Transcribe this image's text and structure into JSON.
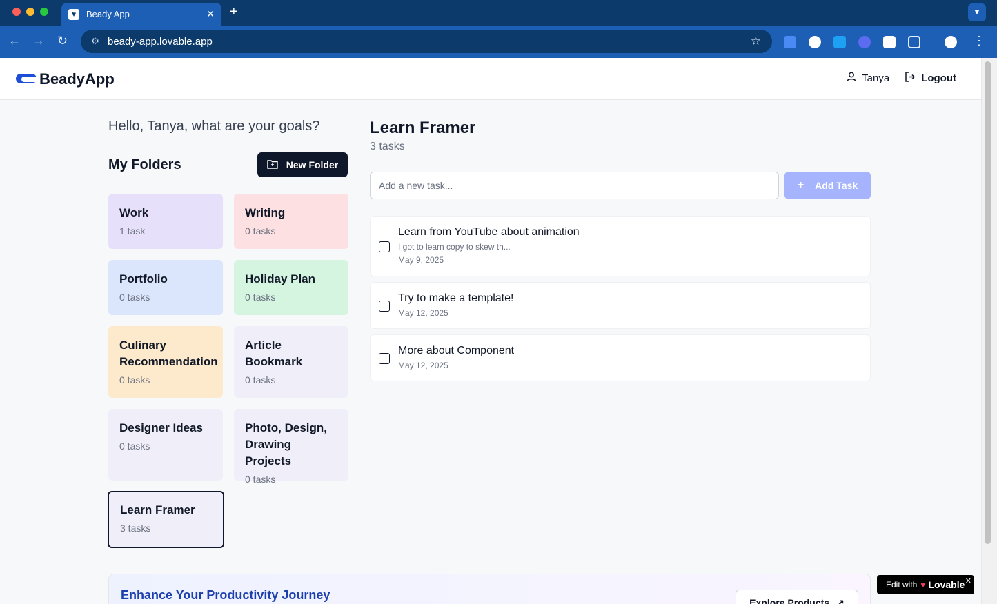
{
  "browser": {
    "tab_title": "Beady App",
    "url": "beady-app.lovable.app"
  },
  "header": {
    "logo_text": "BeadyApp",
    "user_name": "Tanya",
    "logout_label": "Logout"
  },
  "sidebar": {
    "greeting": "Hello, Tanya, what are your goals?",
    "folders_title": "My Folders",
    "new_folder_label": "New Folder",
    "folders": [
      {
        "name": "Work",
        "count": "1 task",
        "color": "#e7e0fb"
      },
      {
        "name": "Writing",
        "count": "0 tasks",
        "color": "#fde0e2"
      },
      {
        "name": "Portfolio",
        "count": "0 tasks",
        "color": "#dbe6fd"
      },
      {
        "name": "Holiday Plan",
        "count": "0 tasks",
        "color": "#d6f5e1"
      },
      {
        "name": "Culinary Recommendation",
        "count": "0 tasks",
        "color": "#fde9cc"
      },
      {
        "name": "Article Bookmark",
        "count": "0 tasks",
        "color": "#f0eff9"
      },
      {
        "name": "Designer Ideas",
        "count": "0 tasks",
        "color": "#f0eff9"
      },
      {
        "name": "Photo, Design, Drawing Projects",
        "count": "0 tasks",
        "color": "#f0eff9"
      },
      {
        "name": "Learn Framer",
        "count": "3 tasks",
        "color": "#f0eff9"
      }
    ]
  },
  "main": {
    "list_title": "Learn Framer",
    "list_count": "3 tasks",
    "input_placeholder": "Add a new task...",
    "add_task_label": "Add Task",
    "tasks": [
      {
        "title": "Learn from YouTube about animation",
        "description": "I got to learn copy to skew th...",
        "date": "May 9, 2025"
      },
      {
        "title": "Try to make a template!",
        "date": "May 12, 2025"
      },
      {
        "title": "More about Component",
        "date": "May 12, 2025"
      }
    ]
  },
  "banner": {
    "title": "Enhance Your Productivity Journey",
    "button_label": "Explore Products"
  },
  "badge": {
    "prefix": "Edit with",
    "brand": "Lovable"
  },
  "colors": {
    "primary_dark": "#0f172a",
    "accent_soft": "#a5b4fc",
    "browser_blue": "#1d5fb4"
  }
}
